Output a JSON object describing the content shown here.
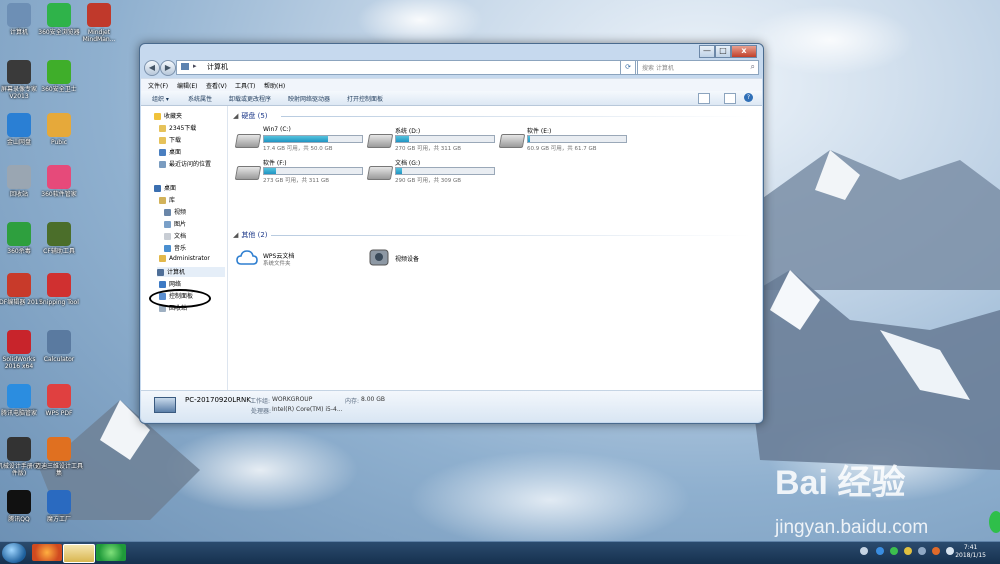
{
  "desktop_icons": [
    {
      "label": "计算机",
      "color": "#6d8fb5"
    },
    {
      "label": "360安全浏览器",
      "color": "#2fb34a"
    },
    {
      "label": "Mindjet MindMan...",
      "color": "#c0392b"
    },
    {
      "label": "屏幕录像专家 V2013",
      "color": "#3a3a3a"
    },
    {
      "label": "360安全卫士",
      "color": "#3fae2a"
    },
    {
      "label": "金山网盘",
      "color": "#2a7fd4"
    },
    {
      "label": "Pubic",
      "color": "#e6a93a"
    },
    {
      "label": "回收站",
      "color": "#9aa6b2"
    },
    {
      "label": "360软件管家",
      "color": "#e64a7a"
    },
    {
      "label": "360杀毒",
      "color": "#2e9f3e"
    },
    {
      "label": "CF辅助工具",
      "color": "#4b6e2a"
    },
    {
      "label": "PDF编辑器 2017",
      "color": "#c83a2a"
    },
    {
      "label": "Snipping Tool",
      "color": "#d03030"
    },
    {
      "label": "SolidWorks 2016 x64",
      "color": "#c8242b"
    },
    {
      "label": "Calculator",
      "color": "#5a7aa0"
    },
    {
      "label": "腾讯电脑管家",
      "color": "#2b8de0"
    },
    {
      "label": "WPS PDF",
      "color": "#e04040"
    },
    {
      "label": "机械设计手册(软件版)",
      "color": "#333333"
    },
    {
      "label": "迈迪三维设计工具集",
      "color": "#e07020"
    },
    {
      "label": "腾讯QQ",
      "color": "#111111"
    },
    {
      "label": "魔方工厂",
      "color": "#2a6ac0"
    }
  ],
  "window": {
    "title_buttons": [
      "—",
      "□",
      "x"
    ],
    "address": "计算机",
    "search_placeholder": "搜索 计算机",
    "menu": [
      "文件(F)",
      "编辑(E)",
      "查看(V)",
      "工具(T)",
      "帮助(H)"
    ],
    "commands": [
      "组织 ▾",
      "系统属性",
      "卸载或更改程序",
      "映射网络驱动器",
      "打开控制面板"
    ],
    "nav": {
      "favorites": "收藏夹",
      "fav_items": [
        "2345下载",
        "下载",
        "桌面",
        "最近访问的位置"
      ],
      "desktop": "桌面",
      "library": "库",
      "lib_items": [
        "视频",
        "图片",
        "文档",
        "音乐"
      ],
      "admin": "Administrator",
      "computer": "计算机",
      "network": "网络",
      "control_panel": "控制面板",
      "recycle": "回收站"
    },
    "hard_disks_header": "硬盘 (5)",
    "drives": [
      {
        "name": "Win7 (C:)",
        "size": "17.4 GB 可用，共 50.0 GB",
        "used_fraction": 0.65
      },
      {
        "name": "系统 (D:)",
        "size": "270 GB 可用，共 311 GB",
        "used_fraction": 0.13
      },
      {
        "name": "软件 (E:)",
        "size": "60.9 GB 可用，共 61.7 GB",
        "used_fraction": 0.02
      },
      {
        "name": "软件 (F:)",
        "size": "273 GB 可用，共 311 GB",
        "used_fraction": 0.12
      },
      {
        "name": "文档 (G:)",
        "size": "290 GB 可用，共 309 GB",
        "used_fraction": 0.06
      }
    ],
    "other_header": "其他 (2)",
    "others": [
      {
        "name": "WPS云文档",
        "sub": "系统文件夹"
      },
      {
        "name": "视频设备",
        "sub": ""
      }
    ],
    "details": {
      "pc_name": "PC-20170920LRNK",
      "workgroup_label": "工作组:",
      "workgroup": "WORKGROUP",
      "memory_label": "内存:",
      "memory": "8.00 GB",
      "cpu_label": "处理器:",
      "cpu": "Intel(R) Core(TM) i5-4..."
    }
  },
  "taskbar": {
    "time": "7:41",
    "date": "2018/1/15"
  },
  "watermark": {
    "line1": "Bai 经验",
    "line2": "jingyan.baidu.com"
  }
}
